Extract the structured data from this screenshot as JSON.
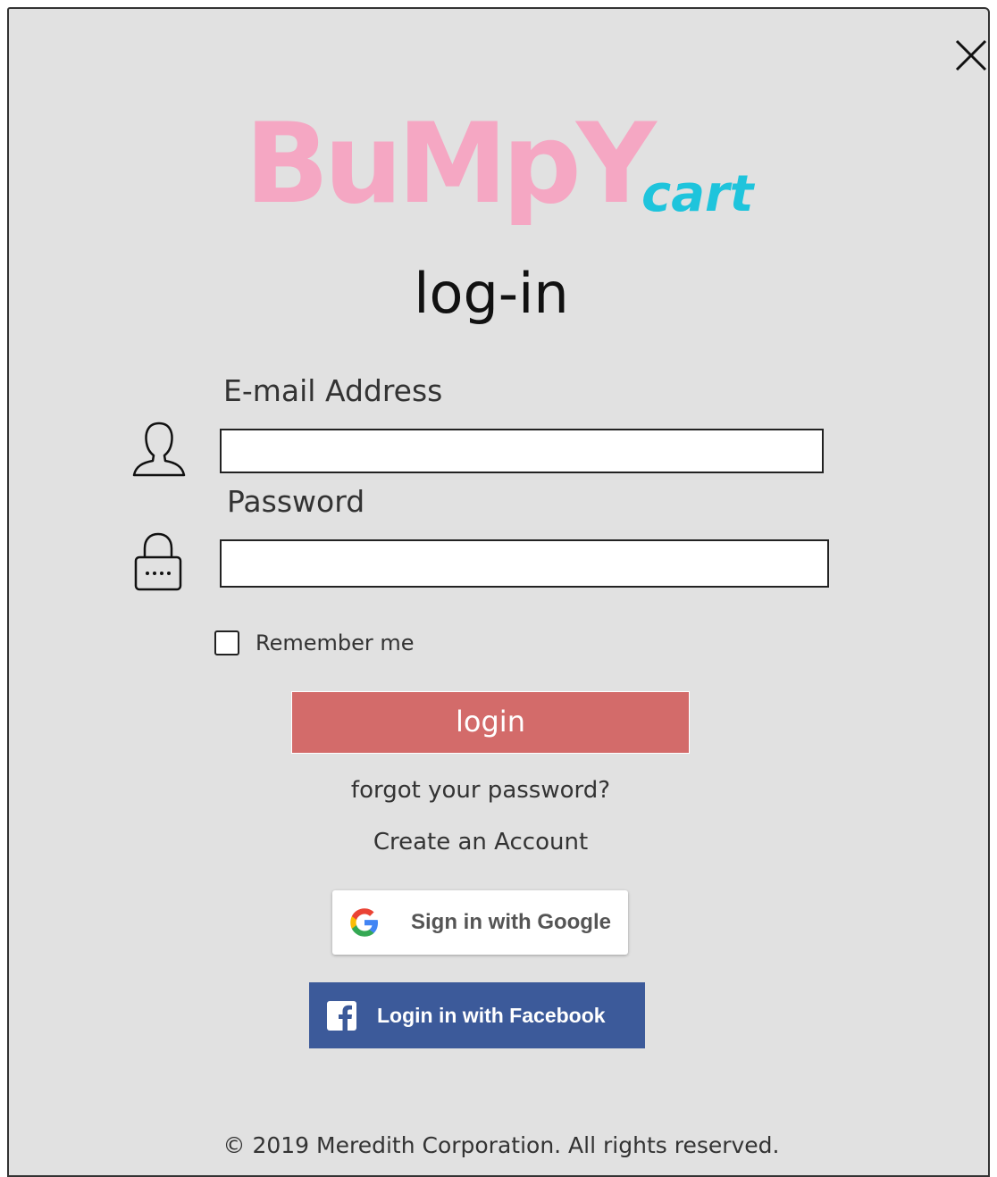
{
  "logo": {
    "main": "BuMpY",
    "sub": "cart"
  },
  "heading": "log-in",
  "email": {
    "label": "E-mail Address",
    "value": "",
    "placeholder": ""
  },
  "password": {
    "label": "Password",
    "value": "",
    "placeholder": ""
  },
  "remember": {
    "label": "Remember me",
    "checked": false
  },
  "login_button": "login",
  "links": {
    "forgot": "forgot your password?",
    "create": "Create an Account"
  },
  "google_button": "Sign in with Google",
  "facebook_button": "Login in with Facebook",
  "footer": "© 2019 Meredith Corporation. All rights reserved.",
  "colors": {
    "logo_pink": "#f5a7c3",
    "logo_cyan": "#1ec4dc",
    "login_button": "#d36b6a",
    "facebook_blue": "#3c5a9a",
    "panel_bg": "#e1e1e1"
  },
  "icons": [
    "close-icon",
    "user-icon",
    "lock-icon",
    "google-icon",
    "facebook-icon"
  ]
}
